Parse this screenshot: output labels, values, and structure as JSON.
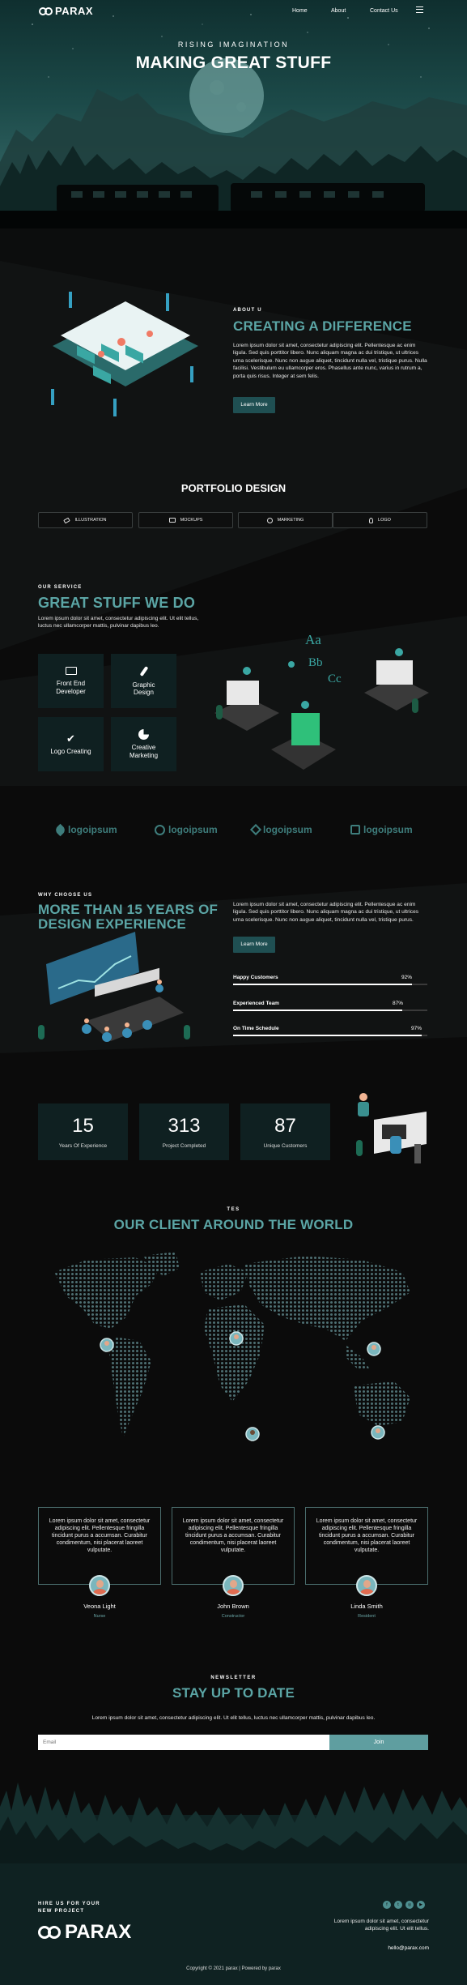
{
  "nav": {
    "brand": "PARAX",
    "links": [
      "Home",
      "About",
      "Contact Us"
    ]
  },
  "hero": {
    "kicker": "RISING IMAGINATION",
    "title": "MAKING GREAT STUFF"
  },
  "about": {
    "label": "ABOUT U",
    "title": "CREATING A DIFFERENCE",
    "body": "Lorem ipsum dolor sit amet, consectetur adipiscing elit. Pellentesque ac enim ligula. Sed quis porttitor libero. Nunc aliquam magna ac dui tristique, ut ultrices urna scelerisque. Nunc non augue aliquet, tincidunt nulla vel, tristique purus. Nulla facilisi. Vestibulum eu ullamcorper eros. Phasellus ante nunc, varius in rutrum a, porta quis risus. Integer at sem felis.",
    "button": "Learn More"
  },
  "portfolio": {
    "title": "PORTFOLIO DESIGN",
    "tabs": [
      {
        "label": "ILLUSTRATION",
        "icon": "brush-icon"
      },
      {
        "label": "MOCKUPS",
        "icon": "monitor-icon"
      },
      {
        "label": "MARKETING",
        "icon": "chart-icon"
      },
      {
        "label": "LOGO",
        "icon": "bulb-icon"
      }
    ]
  },
  "services": {
    "label": "OUR SERVICE",
    "title": "GREAT STUFF WE DO",
    "body": "Lorem ipsum dolor sit amet, consectetur adipiscing elit. Ut elit tellus, luctus nec ullamcorper mattis, pulvinar dapibus leo.",
    "cards": [
      {
        "label": "Front End Developer",
        "icon": "code-icon"
      },
      {
        "label": "Graphic Design",
        "icon": "brush-icon"
      },
      {
        "label": "Logo Creating",
        "icon": "check-icon"
      },
      {
        "label": "Creative Marketing",
        "icon": "pie-chart-icon"
      }
    ]
  },
  "partners": [
    "logoipsum",
    "logoipsum",
    "logoipsum",
    "logoipsum"
  ],
  "why": {
    "label": "WHY CHOOSE US",
    "title_line1": "MORE THAN 15 YEARS OF",
    "title_line2": "DESIGN EXPERIENCE",
    "body": "Lorem ipsum dolor sit amet, consectetur adipiscing elit. Pellentesque ac enim ligula. Sed quis porttitor libero. Nunc aliquam magna ac dui tristique, ut ultrices urna scelerisque. Nunc non augue aliquet, tincidunt nulla vel, tristique purus.",
    "button": "Learn More",
    "bars": [
      {
        "label": "Happy Customers",
        "value": "92%",
        "fraction": 0.92
      },
      {
        "label": "Experienced Team",
        "value": "87%",
        "fraction": 0.87
      },
      {
        "label": "On Time Schedule",
        "value": "97%",
        "fraction": 0.97
      }
    ]
  },
  "stats": [
    {
      "value": "15",
      "label": "Years Of Experience"
    },
    {
      "value": "313",
      "label": "Project Completed"
    },
    {
      "value": "87",
      "label": "Unique Customers"
    }
  ],
  "clients": {
    "label": "TES",
    "title": "OUR CLIENT AROUND THE WORLD"
  },
  "testimonials": [
    {
      "text": "Lorem ipsum dolor sit amet, consectetur adipiscing elit. Pellentesque fringilla tincidunt purus a accumsan. Curabitur condimentum, nisi placerat laoreet vulputate.",
      "name": "Veona Light",
      "role": "Nurse"
    },
    {
      "text": "Lorem ipsum dolor sit amet, consectetur adipiscing elit. Pellentesque fringilla tincidunt purus a accumsan. Curabitur condimentum, nisi placerat laoreet vulputate.",
      "name": "John Brown",
      "role": "Constructor"
    },
    {
      "text": "Lorem ipsum dolor sit amet, consectetur adipiscing elit. Pellentesque fringilla tincidunt purus a accumsan. Curabitur condimentum, nisi placerat laoreet vulputate.",
      "name": "Linda Smith",
      "role": "Resident"
    }
  ],
  "newsletter": {
    "label": "NEWSLETTER",
    "title": "STAY UP TO DATE",
    "body": "Lorem ipsum dolor sit amet, consectetur adipiscing elit. Ut elit tellus, luctus nec ullamcorper mattis, pulvinar dapibus leo.",
    "placeholder": "Email",
    "button": "Join"
  },
  "footer": {
    "label_line1": "HIRE US FOR YOUR",
    "label_line2": "NEW PROJECT",
    "brand": "PARAX",
    "text": "Lorem ipsum dolor sit amet, consectetur adipiscing elit. Ut elit tellus.",
    "email": "hello@parax.com",
    "copyright": "Copyright © 2021 parax | Powered by parax",
    "social_icons": [
      "facebook-icon",
      "twitter-icon",
      "instagram-icon",
      "youtube-icon"
    ]
  },
  "colors": {
    "accent": "#5ba5a5",
    "dark": "#0b0b0b",
    "card": "#0f2021",
    "button": "#1f4f52"
  }
}
